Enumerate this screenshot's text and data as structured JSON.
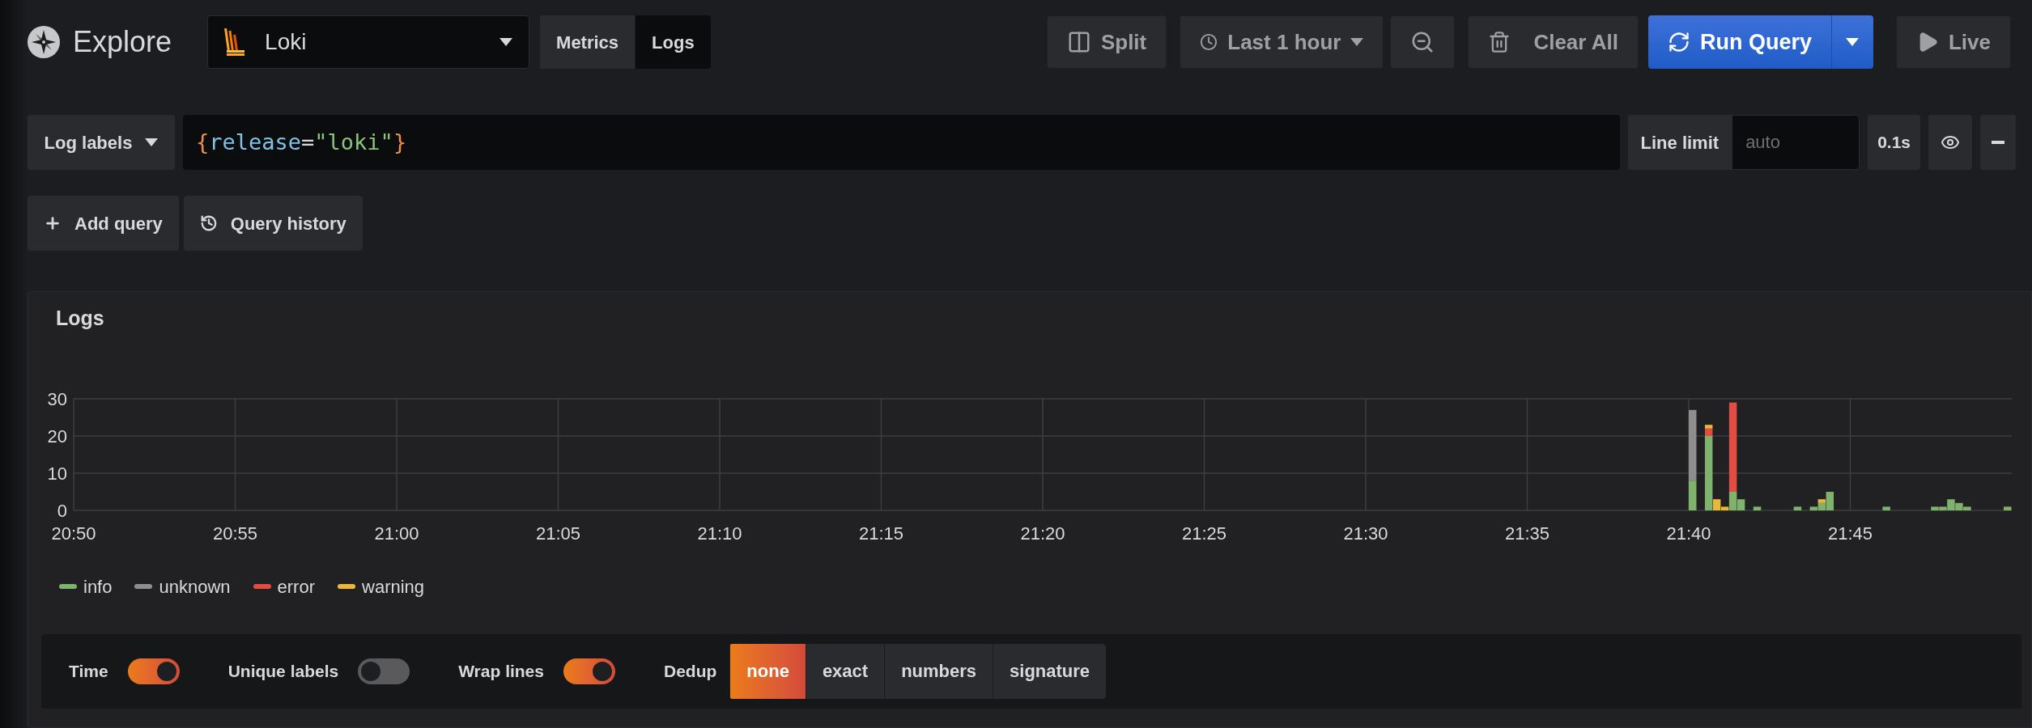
{
  "header": {
    "title": "Explore",
    "datasource": "Loki",
    "mode_tabs": [
      {
        "label": "Metrics",
        "selected": false
      },
      {
        "label": "Logs",
        "selected": true
      }
    ],
    "actions": {
      "split": "Split",
      "time_range": "Last 1 hour",
      "clear_all": "Clear All",
      "run_query": "Run Query",
      "live": "Live"
    }
  },
  "query_row": {
    "label_picker": "Log labels",
    "query_tokens": [
      {
        "text": "{",
        "kind": "brace"
      },
      {
        "text": "release",
        "kind": "label"
      },
      {
        "text": "=",
        "kind": "operator"
      },
      {
        "text": "\"loki\"",
        "kind": "string"
      },
      {
        "text": "}",
        "kind": "brace"
      }
    ],
    "line_limit_label": "Line limit",
    "line_limit_placeholder": "auto",
    "duration": "0.1s"
  },
  "query_actions": [
    {
      "kind": "add",
      "label": "Add query"
    },
    {
      "kind": "history",
      "label": "Query history"
    }
  ],
  "logs_panel": {
    "title": "Logs",
    "chart_data": {
      "type": "bar",
      "stacked": true,
      "categories": [
        "20:50",
        null,
        null,
        null,
        null,
        null,
        null,
        null,
        null,
        null,
        null,
        null,
        null,
        null,
        null,
        null,
        null,
        null,
        null,
        null,
        "20:55",
        null,
        null,
        null,
        null,
        null,
        null,
        null,
        null,
        null,
        null,
        null,
        null,
        null,
        null,
        null,
        null,
        null,
        null,
        null,
        "21:00",
        null,
        null,
        null,
        null,
        null,
        null,
        null,
        null,
        null,
        null,
        null,
        null,
        null,
        null,
        null,
        null,
        null,
        null,
        null,
        "21:05",
        null,
        null,
        null,
        null,
        null,
        null,
        null,
        null,
        null,
        null,
        null,
        null,
        null,
        null,
        null,
        null,
        null,
        null,
        null,
        "21:10",
        null,
        null,
        null,
        null,
        null,
        null,
        null,
        null,
        null,
        null,
        null,
        null,
        null,
        null,
        null,
        null,
        null,
        null,
        null,
        "21:15",
        null,
        null,
        null,
        null,
        null,
        null,
        null,
        null,
        null,
        null,
        null,
        null,
        null,
        null,
        null,
        null,
        null,
        null,
        null,
        "21:20",
        null,
        null,
        null,
        null,
        null,
        null,
        null,
        null,
        null,
        null,
        null,
        null,
        null,
        null,
        null,
        null,
        null,
        null,
        null,
        "21:25",
        null,
        null,
        null,
        null,
        null,
        null,
        null,
        null,
        null,
        null,
        null,
        null,
        null,
        null,
        null,
        null,
        null,
        null,
        null,
        "21:30",
        null,
        null,
        null,
        null,
        null,
        null,
        null,
        null,
        null,
        null,
        null,
        null,
        null,
        null,
        null,
        null,
        null,
        null,
        null,
        "21:35",
        null,
        null,
        null,
        null,
        null,
        null,
        null,
        null,
        null,
        null,
        null,
        null,
        null,
        null,
        null,
        null,
        null,
        null,
        null,
        "21:40",
        null,
        null,
        null,
        null,
        null,
        null,
        null,
        null,
        null,
        null,
        null,
        null,
        null,
        null,
        null,
        null,
        null,
        null,
        null,
        "21:45",
        null,
        null,
        null,
        null,
        null,
        null,
        null,
        null,
        null,
        null,
        null,
        null,
        null,
        null,
        null,
        null,
        null,
        null,
        null
      ],
      "series": [
        {
          "name": "info",
          "color": "#7eb26d",
          "values": [
            0,
            0,
            0,
            0,
            0,
            0,
            0,
            0,
            0,
            0,
            0,
            0,
            0,
            0,
            0,
            0,
            0,
            0,
            0,
            0,
            0,
            0,
            0,
            0,
            0,
            0,
            0,
            0,
            0,
            0,
            0,
            0,
            0,
            0,
            0,
            0,
            0,
            0,
            0,
            0,
            0,
            0,
            0,
            0,
            0,
            0,
            0,
            0,
            0,
            0,
            0,
            0,
            0,
            0,
            0,
            0,
            0,
            0,
            0,
            0,
            0,
            0,
            0,
            0,
            0,
            0,
            0,
            0,
            0,
            0,
            0,
            0,
            0,
            0,
            0,
            0,
            0,
            0,
            0,
            0,
            0,
            0,
            0,
            0,
            0,
            0,
            0,
            0,
            0,
            0,
            0,
            0,
            0,
            0,
            0,
            0,
            0,
            0,
            0,
            0,
            0,
            0,
            0,
            0,
            0,
            0,
            0,
            0,
            0,
            0,
            0,
            0,
            0,
            0,
            0,
            0,
            0,
            0,
            0,
            0,
            0,
            0,
            0,
            0,
            0,
            0,
            0,
            0,
            0,
            0,
            0,
            0,
            0,
            0,
            0,
            0,
            0,
            0,
            0,
            0,
            0,
            0,
            0,
            0,
            0,
            0,
            0,
            0,
            0,
            0,
            0,
            0,
            0,
            0,
            0,
            0,
            0,
            0,
            0,
            0,
            0,
            0,
            0,
            0,
            0,
            0,
            0,
            0,
            0,
            0,
            0,
            0,
            0,
            0,
            0,
            0,
            0,
            0,
            0,
            0,
            0,
            0,
            0,
            0,
            0,
            0,
            0,
            0,
            0,
            0,
            0,
            0,
            0,
            0,
            0,
            0,
            0,
            0,
            0,
            0,
            8,
            0,
            20,
            0,
            0,
            5,
            3,
            0,
            1,
            0,
            0,
            0,
            0,
            1,
            0,
            1,
            2,
            5,
            0,
            0,
            0,
            0,
            0,
            0,
            1,
            0,
            0,
            0,
            0,
            0,
            1,
            1,
            3,
            2,
            1,
            0,
            0,
            0,
            0,
            1
          ]
        },
        {
          "name": "unknown",
          "color": "#8e8e8e",
          "values": [
            0,
            0,
            0,
            0,
            0,
            0,
            0,
            0,
            0,
            0,
            0,
            0,
            0,
            0,
            0,
            0,
            0,
            0,
            0,
            0,
            0,
            0,
            0,
            0,
            0,
            0,
            0,
            0,
            0,
            0,
            0,
            0,
            0,
            0,
            0,
            0,
            0,
            0,
            0,
            0,
            0,
            0,
            0,
            0,
            0,
            0,
            0,
            0,
            0,
            0,
            0,
            0,
            0,
            0,
            0,
            0,
            0,
            0,
            0,
            0,
            0,
            0,
            0,
            0,
            0,
            0,
            0,
            0,
            0,
            0,
            0,
            0,
            0,
            0,
            0,
            0,
            0,
            0,
            0,
            0,
            0,
            0,
            0,
            0,
            0,
            0,
            0,
            0,
            0,
            0,
            0,
            0,
            0,
            0,
            0,
            0,
            0,
            0,
            0,
            0,
            0,
            0,
            0,
            0,
            0,
            0,
            0,
            0,
            0,
            0,
            0,
            0,
            0,
            0,
            0,
            0,
            0,
            0,
            0,
            0,
            0,
            0,
            0,
            0,
            0,
            0,
            0,
            0,
            0,
            0,
            0,
            0,
            0,
            0,
            0,
            0,
            0,
            0,
            0,
            0,
            0,
            0,
            0,
            0,
            0,
            0,
            0,
            0,
            0,
            0,
            0,
            0,
            0,
            0,
            0,
            0,
            0,
            0,
            0,
            0,
            0,
            0,
            0,
            0,
            0,
            0,
            0,
            0,
            0,
            0,
            0,
            0,
            0,
            0,
            0,
            0,
            0,
            0,
            0,
            0,
            0,
            0,
            0,
            0,
            0,
            0,
            0,
            0,
            0,
            0,
            0,
            0,
            0,
            0,
            0,
            0,
            0,
            0,
            0,
            0,
            19,
            0,
            0,
            0,
            0,
            0,
            0,
            0,
            0,
            0,
            0,
            0,
            0,
            0,
            0,
            0,
            0,
            0,
            0,
            0,
            0,
            0,
            0,
            0,
            0,
            0,
            0,
            0,
            0,
            0,
            0,
            0,
            0,
            0,
            0,
            0,
            0,
            0,
            0,
            0
          ]
        },
        {
          "name": "error",
          "color": "#e24d42",
          "values": [
            0,
            0,
            0,
            0,
            0,
            0,
            0,
            0,
            0,
            0,
            0,
            0,
            0,
            0,
            0,
            0,
            0,
            0,
            0,
            0,
            0,
            0,
            0,
            0,
            0,
            0,
            0,
            0,
            0,
            0,
            0,
            0,
            0,
            0,
            0,
            0,
            0,
            0,
            0,
            0,
            0,
            0,
            0,
            0,
            0,
            0,
            0,
            0,
            0,
            0,
            0,
            0,
            0,
            0,
            0,
            0,
            0,
            0,
            0,
            0,
            0,
            0,
            0,
            0,
            0,
            0,
            0,
            0,
            0,
            0,
            0,
            0,
            0,
            0,
            0,
            0,
            0,
            0,
            0,
            0,
            0,
            0,
            0,
            0,
            0,
            0,
            0,
            0,
            0,
            0,
            0,
            0,
            0,
            0,
            0,
            0,
            0,
            0,
            0,
            0,
            0,
            0,
            0,
            0,
            0,
            0,
            0,
            0,
            0,
            0,
            0,
            0,
            0,
            0,
            0,
            0,
            0,
            0,
            0,
            0,
            0,
            0,
            0,
            0,
            0,
            0,
            0,
            0,
            0,
            0,
            0,
            0,
            0,
            0,
            0,
            0,
            0,
            0,
            0,
            0,
            0,
            0,
            0,
            0,
            0,
            0,
            0,
            0,
            0,
            0,
            0,
            0,
            0,
            0,
            0,
            0,
            0,
            0,
            0,
            0,
            0,
            0,
            0,
            0,
            0,
            0,
            0,
            0,
            0,
            0,
            0,
            0,
            0,
            0,
            0,
            0,
            0,
            0,
            0,
            0,
            0,
            0,
            0,
            0,
            0,
            0,
            0,
            0,
            0,
            0,
            0,
            0,
            0,
            0,
            0,
            0,
            0,
            0,
            0,
            0,
            0,
            0,
            2,
            0,
            0,
            24,
            0,
            0,
            0,
            0,
            0,
            0,
            0,
            0,
            0,
            0,
            0,
            0,
            0,
            0,
            0,
            0,
            0,
            0,
            0,
            0,
            0,
            0,
            0,
            0,
            0,
            0,
            0,
            0,
            0,
            0,
            0,
            0,
            0,
            0
          ]
        },
        {
          "name": "warning",
          "color": "#eab839",
          "values": [
            0,
            0,
            0,
            0,
            0,
            0,
            0,
            0,
            0,
            0,
            0,
            0,
            0,
            0,
            0,
            0,
            0,
            0,
            0,
            0,
            0,
            0,
            0,
            0,
            0,
            0,
            0,
            0,
            0,
            0,
            0,
            0,
            0,
            0,
            0,
            0,
            0,
            0,
            0,
            0,
            0,
            0,
            0,
            0,
            0,
            0,
            0,
            0,
            0,
            0,
            0,
            0,
            0,
            0,
            0,
            0,
            0,
            0,
            0,
            0,
            0,
            0,
            0,
            0,
            0,
            0,
            0,
            0,
            0,
            0,
            0,
            0,
            0,
            0,
            0,
            0,
            0,
            0,
            0,
            0,
            0,
            0,
            0,
            0,
            0,
            0,
            0,
            0,
            0,
            0,
            0,
            0,
            0,
            0,
            0,
            0,
            0,
            0,
            0,
            0,
            0,
            0,
            0,
            0,
            0,
            0,
            0,
            0,
            0,
            0,
            0,
            0,
            0,
            0,
            0,
            0,
            0,
            0,
            0,
            0,
            0,
            0,
            0,
            0,
            0,
            0,
            0,
            0,
            0,
            0,
            0,
            0,
            0,
            0,
            0,
            0,
            0,
            0,
            0,
            0,
            0,
            0,
            0,
            0,
            0,
            0,
            0,
            0,
            0,
            0,
            0,
            0,
            0,
            0,
            0,
            0,
            0,
            0,
            0,
            0,
            0,
            0,
            0,
            0,
            0,
            0,
            0,
            0,
            0,
            0,
            0,
            0,
            0,
            0,
            0,
            0,
            0,
            0,
            0,
            0,
            0,
            0,
            0,
            0,
            0,
            0,
            0,
            0,
            0,
            0,
            0,
            0,
            0,
            0,
            0,
            0,
            0,
            0,
            0,
            0,
            0,
            0,
            1,
            3,
            1,
            0,
            0,
            0,
            0,
            0,
            0,
            0,
            0,
            0,
            0,
            0,
            1,
            0,
            0,
            0,
            0,
            0,
            0,
            0,
            0,
            0,
            0,
            0,
            0,
            0,
            0,
            0,
            0,
            0,
            0,
            0,
            0,
            0,
            0,
            0
          ]
        }
      ],
      "ylim": [
        0,
        30
      ],
      "yticks": [
        0,
        10,
        20,
        30
      ]
    },
    "options": {
      "toggles": [
        {
          "label": "Time",
          "on": true
        },
        {
          "label": "Unique labels",
          "on": false
        },
        {
          "label": "Wrap lines",
          "on": true
        }
      ],
      "dedup_label": "Dedup",
      "dedup": [
        {
          "label": "none",
          "selected": true
        },
        {
          "label": "exact",
          "selected": false
        },
        {
          "label": "numbers",
          "selected": false
        },
        {
          "label": "signature",
          "selected": false
        }
      ]
    }
  }
}
